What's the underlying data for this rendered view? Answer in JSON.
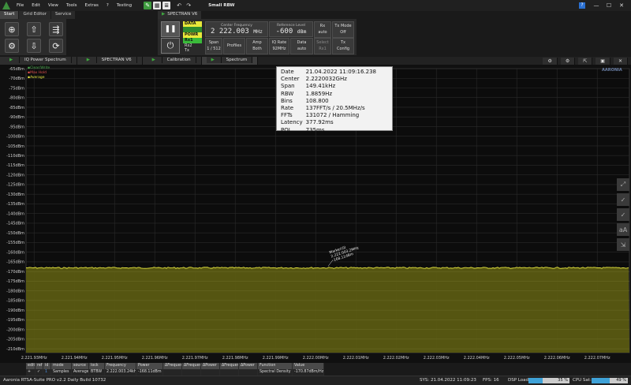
{
  "menubar": {
    "items": [
      "File",
      "Edit",
      "View",
      "Tools",
      "Extras",
      "?",
      "Testing"
    ],
    "window_title": "Small RBW",
    "help": "?"
  },
  "ribbon_tabs": [
    "Start",
    "Grid Editor",
    "Service"
  ],
  "spectran": {
    "tab_label": "SPECTRAN V6",
    "data_badge": "DATA",
    "powr_badge": "POWR",
    "rx1_badge": "Rx1",
    "rx2": "Rx2",
    "tx": "Tx",
    "center_frequency": {
      "label": "Center Frequency",
      "value": "2 222.003",
      "unit": "MHz"
    },
    "reference_level": {
      "label": "Reference Level",
      "value": "-600",
      "unit": "dBm"
    },
    "rx": {
      "label": "Rx",
      "value": "auto"
    },
    "tx_mode": {
      "label": "Tx Mode",
      "value": "Off"
    },
    "span": {
      "label": "Span",
      "value": "1 / 512"
    },
    "profiles": "Profiles",
    "amp": {
      "label": "Amp",
      "value": "Both"
    },
    "iq_rate": {
      "label": "IQ Rate",
      "value": "92MHz"
    },
    "data": {
      "label": "Data",
      "value": "auto"
    },
    "select": {
      "label": "Select",
      "value": "Rx1"
    },
    "tx_config": {
      "label": "Tx",
      "value": "Config"
    }
  },
  "view_tabs": [
    "IQ Power Spectrum",
    "SPECTRAN V6",
    "Calibration",
    "Spectrum"
  ],
  "legend": [
    {
      "label": "Clear/Write",
      "color": "#4caf50"
    },
    {
      "label": "Max Hold",
      "color": "#e05050"
    },
    {
      "label": "Average",
      "color": "#e8e840"
    }
  ],
  "info": [
    {
      "k": "Date",
      "v": "21.04.2022 11:09:16.238"
    },
    {
      "k": "Center",
      "v": "2.2220032GHz"
    },
    {
      "k": "Span",
      "v": "149.41kHz"
    },
    {
      "k": "RBW",
      "v": "1.8859Hz"
    },
    {
      "k": "Bins",
      "v": "108.800"
    },
    {
      "k": "Rate",
      "v": "137FFT/s / 20.5MHz/s"
    },
    {
      "k": "FFTs",
      "v": "131072 / Hamming"
    },
    {
      "k": "Latency",
      "v": "377.92ms"
    },
    {
      "k": "POI",
      "v": "735ms"
    }
  ],
  "brand": "AARONIA",
  "marker": {
    "name": "Marker(0)",
    "freq": "2.222.003.2MHz",
    "level": "-168.11dBm"
  },
  "chart_data": {
    "type": "line",
    "y_ticks": [
      "-65dBm",
      "-70dBm",
      "-75dBm",
      "-80dBm",
      "-85dBm",
      "-90dBm",
      "-95dBm",
      "-100dBm",
      "-105dBm",
      "-110dBm",
      "-115dBm",
      "-120dBm",
      "-125dBm",
      "-130dBm",
      "-135dBm",
      "-140dBm",
      "-145dBm",
      "-150dBm",
      "-155dBm",
      "-160dBm",
      "-165dBm",
      "-170dBm",
      "-175dBm",
      "-180dBm",
      "-185dBm",
      "-190dBm",
      "-195dBm",
      "-200dBm",
      "-205dBm",
      "-210dBm"
    ],
    "x_ticks": [
      "2.221.93MHz",
      "2.221.94MHz",
      "2.221.95MHz",
      "2.221.96MHz",
      "2.221.97MHz",
      "2.221.98MHz",
      "2.221.99MHz",
      "2.222.00MHz",
      "2.222.01MHz",
      "2.222.02MHz",
      "2.222.03MHz",
      "2.222.04MHz",
      "2.222.05MHz",
      "2.222.06MHz",
      "2.222.07MHz"
    ],
    "ylim": [
      -212,
      -65
    ],
    "xlim": [
      2221.928,
      2222.078
    ],
    "series": [
      {
        "name": "Average",
        "color": "#e8e840",
        "level": -168.1
      }
    ],
    "fill_color": "#5a5a12"
  },
  "marker_table": {
    "headers": [
      "edit",
      "ref",
      "id",
      "mode",
      "source",
      "lock",
      "Frequency",
      "Power",
      "ΔFrequency",
      "ΔFrequency",
      "ΔPower",
      "ΔFrequency",
      "ΔPower",
      "Function",
      "Value"
    ],
    "row": [
      "+",
      "✓",
      "1",
      "Samples",
      "Average",
      "BTBW",
      "2.222.003.24kHz",
      "-168.11dBm",
      "",
      "",
      "",
      "",
      "",
      "Spectral Density",
      "-170.87dBm/Hz"
    ]
  },
  "status": {
    "version": "Aaronia RTSA-Suite PRO v2.2 Daily Build 10732",
    "sys": "SYS: 21.04.2022 11:09:23",
    "fps": "FPS: 16",
    "dsp_label": "DSP Load:",
    "dsp_value": "35 %",
    "dsp_fraction": 0.35,
    "cpu_label": "CPU Sat:",
    "cpu_value": "49 %",
    "cpu_fraction": 0.49
  }
}
